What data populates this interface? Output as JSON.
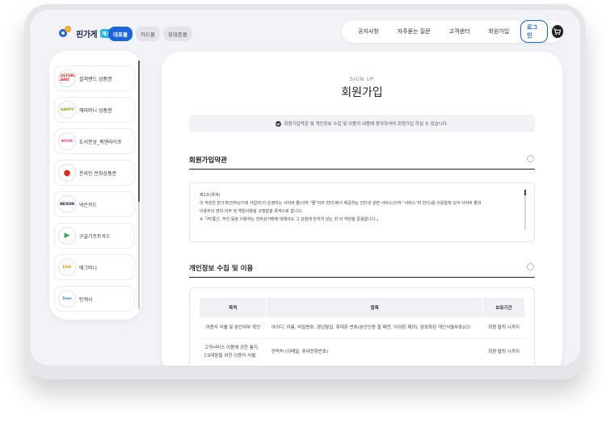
{
  "header": {
    "logo_text": "핀가게",
    "logo_badge": "캐시",
    "pill_tabs": [
      {
        "label": "대표몰",
        "active": true
      },
      {
        "label": "카드몰",
        "active": false
      },
      {
        "label": "휴대폰몰",
        "active": false
      }
    ],
    "nav": [
      "공지사항",
      "자주묻는 질문",
      "고객센터",
      "회원가입"
    ],
    "login_label": "로그인"
  },
  "sidebar": {
    "items": [
      {
        "label": "컬쳐랜드 상품권",
        "icon": "cultureland-logo-icon",
        "icon_text": "CULTURE LAND",
        "color": "#e1251b"
      },
      {
        "label": "해피머니 상품권",
        "icon": "happymoney-logo-icon",
        "icon_text": "HAPPY",
        "color": "#7ab51d"
      },
      {
        "label": "도서문상_북앤라이프",
        "icon": "booknlife-logo-icon",
        "icon_text": "BOOK",
        "color": "#e64b8c"
      },
      {
        "label": "온라인 문화상품권",
        "icon": "online-culture-logo-icon",
        "icon_text": "●",
        "color": "#e1251b"
      },
      {
        "label": "넥슨카드",
        "icon": "nexon-logo-icon",
        "icon_text": "NEXON",
        "color": "#0b1f3a"
      },
      {
        "label": "구글기프트카드",
        "icon": "google-play-logo-icon",
        "icon_text": "▶",
        "color": "#34a853"
      },
      {
        "label": "에그머니",
        "icon": "eggmoney-logo-icon",
        "icon_text": "EGG",
        "color": "#f29100"
      },
      {
        "label": "틴캐시",
        "icon": "teencash-logo-icon",
        "icon_text": "Teen",
        "color": "#2a8fd6"
      }
    ]
  },
  "main": {
    "eyebrow": "SIGN UP",
    "title": "회원가입",
    "notice": "회원가입약관 및 개인정보 수집 및 이용의 내용에 동의하셔야 회원가입 하실 수 있습니다.",
    "terms": {
      "title": "회원가입약관",
      "lines": [
        "제1조(목적)",
        "이 약관은 핀가게(전자상거래 사업자)가 운영하는 사이버 몰(이하 \"몰\"이라 한다)에서 제공하는 인터넷 관련 서비스(이하 \"서비스\"라 한다)를 이용함에 있어 사이버 몰과",
        "이용자의 권리·의무 및 책임사항을 규정함을 목적으로 합니다.",
        "※「PC통신, 무선 등을 이용하는 전자상거래에 대해서도 그 성질에 반하지 않는 한 이 약관을 준용합니다.」"
      ]
    },
    "privacy": {
      "title": "개인정보 수집 및 이용",
      "headers": [
        "목적",
        "항목",
        "보유기간"
      ],
      "rows": [
        [
          "이용자 식별 및 본인여부 확인",
          "아이디, 이름, 비밀번호, 생년월일, 휴대폰 번호(본인인증 할 때만, 아이핀 제외), 암호화된 개인식별부호(CI)",
          "회원 탈퇴 시까지"
        ],
        [
          "고객서비스 이용에 관한 통지, CS대응을 위한 이용자 식별",
          "연락처 (이메일, 휴대전화번호)",
          "회원 탈퇴 시까지"
        ]
      ]
    }
  }
}
